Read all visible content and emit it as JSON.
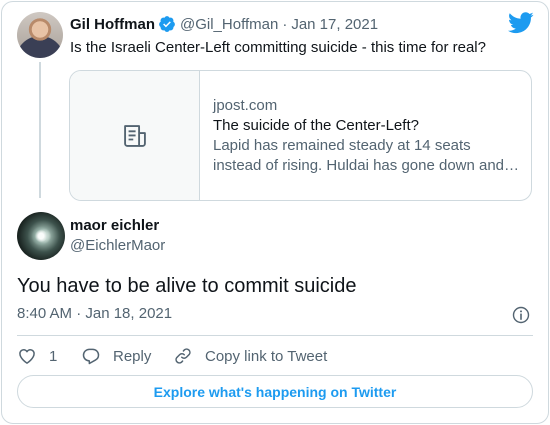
{
  "quoted_tweet": {
    "author_name": "Gil Hoffman",
    "author_handle": "@Gil_Hoffman",
    "separator": "·",
    "date": "Jan 17, 2021",
    "text": "Is the Israeli Center-Left committing suicide - this time for real?",
    "link_card": {
      "domain": "jpost.com",
      "title": "The suicide of the Center-Left?",
      "description_line1": "Lapid has remained steady at 14 seats",
      "description_line2": "instead of rising. Huldai has gone down and…"
    }
  },
  "tweet": {
    "author_name": "maor eichler",
    "author_handle": "@EichlerMaor",
    "text": "You have to be alive to commit suicide",
    "timestamp": "8:40 AM · Jan 18, 2021"
  },
  "actions": {
    "like_count": "1",
    "reply_label": "Reply",
    "copy_link_label": "Copy link to Tweet"
  },
  "explore_label": "Explore what's happening on Twitter",
  "colors": {
    "accent": "#1d9bf0",
    "text_primary": "#0f1419",
    "text_secondary": "#536471",
    "border": "#cfd9de"
  },
  "icons": {
    "verified": "verified-badge-icon",
    "brand": "twitter-bird-icon",
    "link_placeholder": "article-icon",
    "info": "info-icon",
    "like": "heart-icon",
    "reply": "reply-bubble-icon",
    "copy_link": "link-icon"
  }
}
